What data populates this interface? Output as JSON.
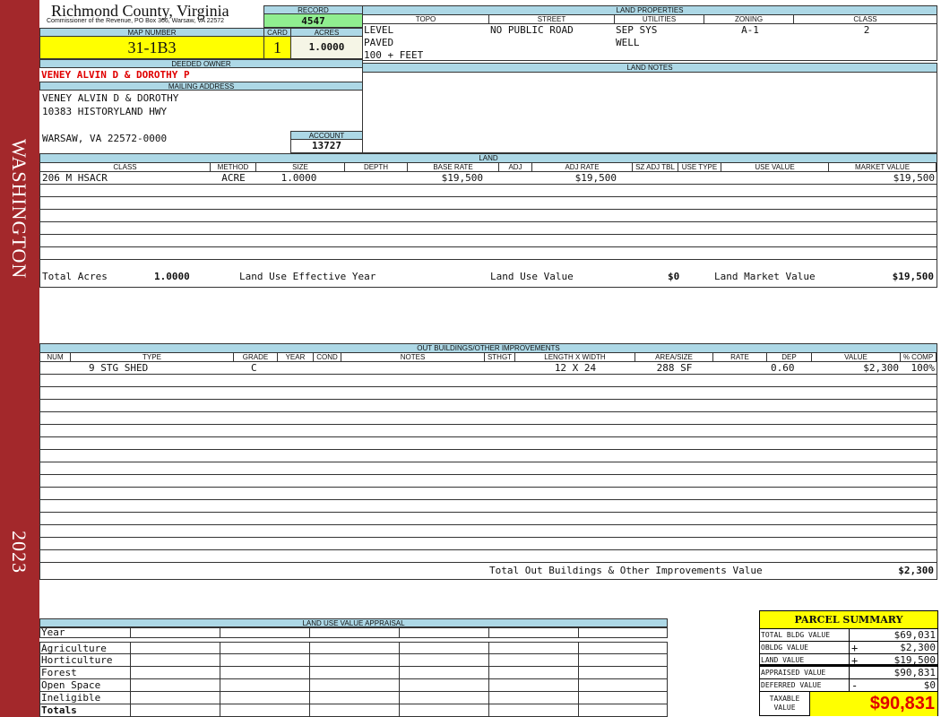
{
  "sidebar": {
    "location": "WASHINGTON",
    "year": "2023"
  },
  "header": {
    "title": "Richmond County, Virginia",
    "subtitle": "Commissioner of the Revenue, PO Box 366, Warsaw, VA 22572"
  },
  "record": {
    "label": "RECORD",
    "value": "4547"
  },
  "map": {
    "label": "MAP NUMBER",
    "value": "31-1B3"
  },
  "card": {
    "label": "CARD",
    "value": "1"
  },
  "acres": {
    "label": "ACRES",
    "value": "1.0000"
  },
  "owner": {
    "label": "DEEDED OWNER",
    "value": "VENEY ALVIN D & DOROTHY P"
  },
  "mailing": {
    "label": "MAILING ADDRESS",
    "line1": "VENEY ALVIN D & DOROTHY",
    "line2": "10383 HISTORYLAND HWY",
    "line3": "WARSAW, VA 22572-0000"
  },
  "account": {
    "label": "ACCOUNT",
    "value": "13727"
  },
  "land_properties": {
    "label": "LAND PROPERTIES",
    "columns": [
      "TOPO",
      "STREET",
      "UTILITIES",
      "ZONING",
      "CLASS"
    ],
    "topo": [
      "LEVEL",
      "PAVED",
      "100 + FEET"
    ],
    "street": [
      "NO PUBLIC ROAD"
    ],
    "utilities": [
      "SEP SYS",
      "WELL"
    ],
    "zoning": [
      "A-1"
    ],
    "class": [
      "2"
    ]
  },
  "land_notes": {
    "label": "LAND NOTES"
  },
  "land": {
    "label": "LAND",
    "columns": [
      "CLASS",
      "METHOD",
      "SIZE",
      "DEPTH",
      "BASE RATE",
      "ADJ",
      "ADJ RATE",
      "SZ ADJ TBL",
      "USE TYPE",
      "USE VALUE",
      "MARKET VALUE"
    ],
    "rows": [
      [
        "206 M HSACR",
        "ACRE",
        "1.0000",
        "",
        "$19,500",
        "",
        "$19,500",
        "",
        "",
        "",
        "$19,500"
      ]
    ],
    "totals": {
      "acres_label": "Total Acres",
      "acres": "1.0000",
      "year_label": "Land Use Effective Year",
      "year": "",
      "use_label": "Land Use Value",
      "use": "$0",
      "market_label": "Land Market Value",
      "market": "$19,500"
    }
  },
  "outbuildings": {
    "label": "OUT BUILDINGS/OTHER IMPROVEMENTS",
    "columns": [
      "NUM",
      "TYPE",
      "GRADE",
      "YEAR",
      "COND",
      "NOTES",
      "STHGT",
      "LENGTH X WIDTH",
      "AREA/SIZE",
      "RATE",
      "DEP",
      "VALUE",
      "% COMP"
    ],
    "rows": [
      [
        "",
        "9 STG SHED",
        "C",
        "",
        "",
        "",
        "",
        "12 X 24",
        "288 SF",
        "",
        "0.60",
        "$2,300",
        "100%"
      ]
    ],
    "total_label": "Total Out Buildings & Other Improvements Value",
    "total": "$2,300"
  },
  "land_use": {
    "label": "LAND USE VALUE APPRAISAL",
    "rows": [
      "Year",
      "Agriculture",
      "Horticulture",
      "Forest",
      "Open Space",
      "Ineligible",
      "Totals"
    ]
  },
  "summary": {
    "title": "PARCEL SUMMARY",
    "rows": [
      {
        "label": "TOTAL BLDG VALUE",
        "sign": "",
        "value": "$69,031"
      },
      {
        "label": "OBLDG VALUE",
        "sign": "+",
        "value": "$2,300"
      },
      {
        "label": "LAND VALUE",
        "sign": "+",
        "value": "$19,500"
      },
      {
        "label": "APPRAISED VALUE",
        "sign": "",
        "value": "$90,831"
      },
      {
        "label": "DEFERRED VALUE",
        "sign": "-",
        "value": "$0"
      }
    ],
    "taxable_label": "TAXABLE VALUE",
    "taxable": "$90,831"
  },
  "colors": {
    "sidebar": "#a3282b",
    "header": "#add8e6",
    "highlight": "#ffff00",
    "record": "#90ee90",
    "owner": "#e00000"
  }
}
